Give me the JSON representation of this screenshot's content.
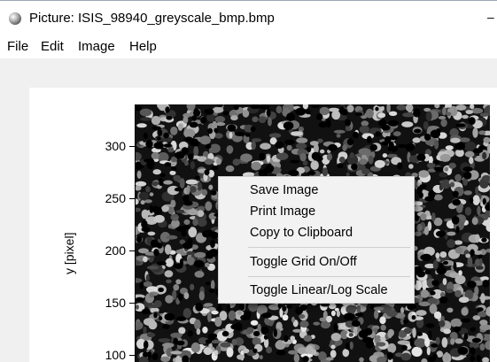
{
  "window": {
    "title": "Picture: ISIS_98940_greyscale_bmp.bmp",
    "minimize_glyph": "–"
  },
  "menu": {
    "file": "File",
    "edit": "Edit",
    "image": "Image",
    "help": "Help"
  },
  "plot": {
    "ylabel": "y [pixel]",
    "yticks": [
      "300",
      "250",
      "200",
      "150",
      "100"
    ]
  },
  "context_menu": {
    "save_image": "Save Image",
    "print_image": "Print Image",
    "copy_to_clipboard": "Copy to Clipboard",
    "toggle_grid": "Toggle Grid On/Off",
    "toggle_scale": "Toggle Linear/Log Scale"
  },
  "icons": {
    "app": "globe-sphere-icon"
  }
}
